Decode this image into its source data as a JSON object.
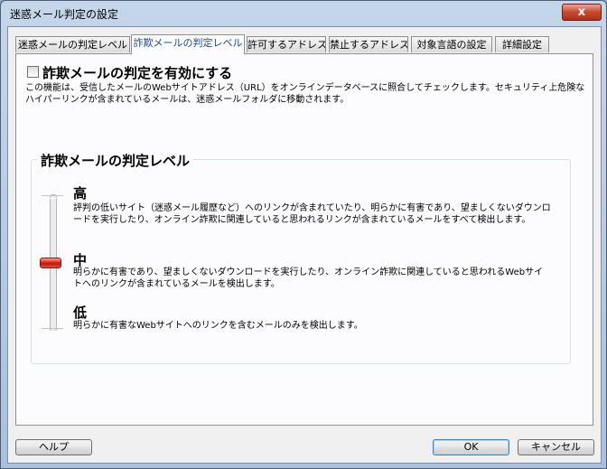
{
  "window": {
    "title": "迷惑メール判定の設定",
    "close_glyph": "x"
  },
  "tabs": [
    {
      "label": "迷惑メールの判定レベル"
    },
    {
      "label": "詐欺メールの判定レベル"
    },
    {
      "label": "許可するアドレス"
    },
    {
      "label": "禁止するアドレス"
    },
    {
      "label": "対象言語の設定"
    },
    {
      "label": "詳細設定"
    }
  ],
  "active_tab": 1,
  "enable": {
    "checked": false,
    "label": "詐欺メールの判定を有効にする",
    "description": "この機能は、受信したメールのWebサイトアドレス（URL）をオンラインデータベースに照合してチェックします。セキュリティ上危険なハイパーリンクが含まれているメールは、迷惑メールフォルダに移動されます。"
  },
  "level_group": {
    "title": "詐欺メールの判定レベル",
    "selected_level": "中",
    "levels": [
      {
        "name": "高",
        "description": "評判の低いサイト（迷惑メール履歴など）へのリンクが含まれていたり、明らかに有害であり、望ましくないダウンロードを実行したり、オンライン詐欺に関連していると思われるリンクが含まれているメールをすべて検出します。"
      },
      {
        "name": "中",
        "description": "明らかに有害であり、望ましくないダウンロードを実行したり、オンライン詐欺に関連していると思われるWebサイトへのリンクが含まれているメールを検出します。"
      },
      {
        "name": "低",
        "description": "明らかに有害なWebサイトへのリンクを含むメールのみを検出します。"
      }
    ]
  },
  "buttons": {
    "help": "ヘルプ",
    "ok": "OK",
    "cancel": "キャンセル"
  }
}
